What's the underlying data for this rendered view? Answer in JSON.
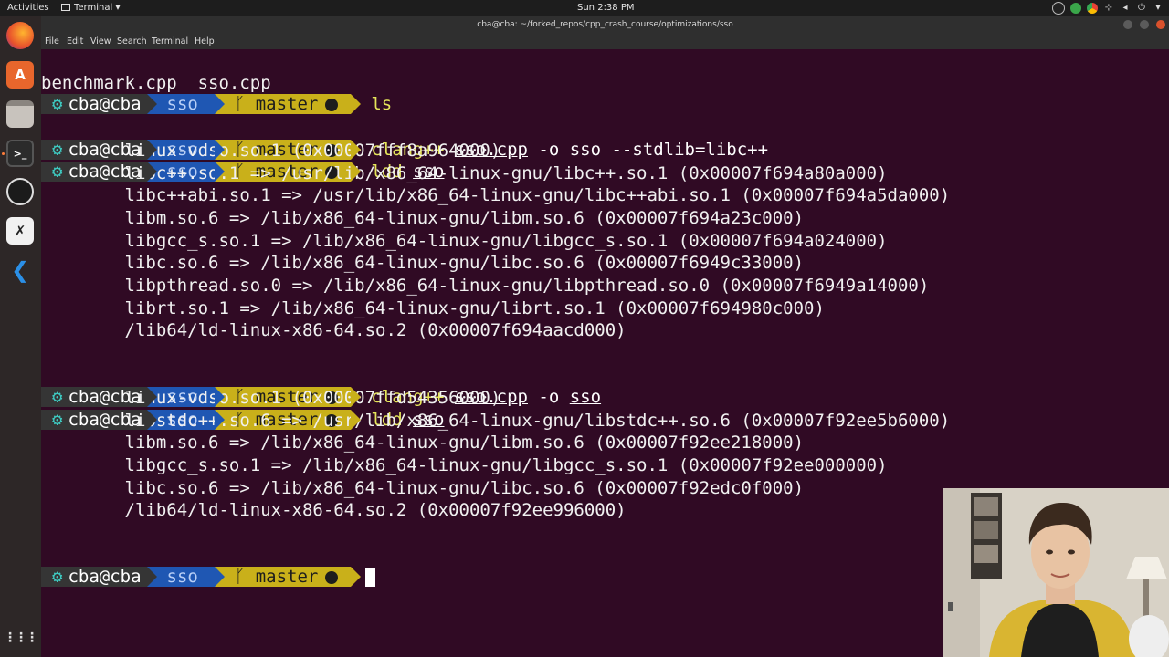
{
  "topbar": {
    "activities": "Activities",
    "app_name": "Terminal",
    "app_caret": "▾",
    "clock": "Sun  2:38 PM"
  },
  "window": {
    "title": "cba@cba: ~/forked_repos/cpp_crash_course/optimizations/sso",
    "menu": [
      "File",
      "Edit",
      "View",
      "Search",
      "Terminal",
      "Help"
    ]
  },
  "prompt": {
    "user": "cba@cba",
    "dir": "sso",
    "branch": "master",
    "branch_icon": "ᚴ"
  },
  "terminal": {
    "cmd1": "ls",
    "out_ls": "benchmark.cpp  sso.cpp",
    "cmd2_a": "clang++",
    "cmd2_b": "sso.cpp",
    "cmd2_c": " -o sso --stdlib=libc++",
    "cmd3_a": "ldd",
    "cmd3_b": "sso",
    "ldd1": [
      "        linux-vdso.so.1 (0x00007fff8a964000)",
      "        libc++.so.1 => /usr/lib/x86_64-linux-gnu/libc++.so.1 (0x00007f694a80a000)",
      "        libc++abi.so.1 => /usr/lib/x86_64-linux-gnu/libc++abi.so.1 (0x00007f694a5da000)",
      "        libm.so.6 => /lib/x86_64-linux-gnu/libm.so.6 (0x00007f694a23c000)",
      "        libgcc_s.so.1 => /lib/x86_64-linux-gnu/libgcc_s.so.1 (0x00007f694a024000)",
      "        libc.so.6 => /lib/x86_64-linux-gnu/libc.so.6 (0x00007f6949c33000)",
      "        libpthread.so.0 => /lib/x86_64-linux-gnu/libpthread.so.0 (0x00007f6949a14000)",
      "        librt.so.1 => /lib/x86_64-linux-gnu/librt.so.1 (0x00007f694980c000)",
      "        /lib64/ld-linux-x86-64.so.2 (0x00007f694aacd000)"
    ],
    "cmd4_a": "clang++",
    "cmd4_b": "sso.cpp",
    "cmd4_c": " -o ",
    "cmd4_d": "sso",
    "cmd5_a": "ldd",
    "cmd5_b": "sso",
    "ldd2": [
      "        linux-vdso.so.1 (0x00007ffd54356000)",
      "        libstdc++.so.6 => /usr/lib/x86_64-linux-gnu/libstdc++.so.6 (0x00007f92ee5b6000)",
      "        libm.so.6 => /lib/x86_64-linux-gnu/libm.so.6 (0x00007f92ee218000)",
      "        libgcc_s.so.1 => /lib/x86_64-linux-gnu/libgcc_s.so.1 (0x00007f92ee000000)",
      "        libc.so.6 => /lib/x86_64-linux-gnu/libc.so.6 (0x00007f92edc0f000)",
      "        /lib64/ld-linux-x86-64.so.2 (0x00007f92ee996000)"
    ]
  },
  "dock": {
    "items": [
      "firefox-icon",
      "software-center-icon",
      "files-icon",
      "terminal-icon",
      "obs-icon",
      "xournal-icon",
      "vscode-icon"
    ],
    "apps_grid": "⋮⋮⋮"
  },
  "colors": {
    "terminal_bg": "#300a24",
    "prompt_user_bg": "#353535",
    "prompt_dir_bg": "#1f57b3",
    "prompt_git_bg": "#c9b01a",
    "command": "#e5e55a"
  }
}
